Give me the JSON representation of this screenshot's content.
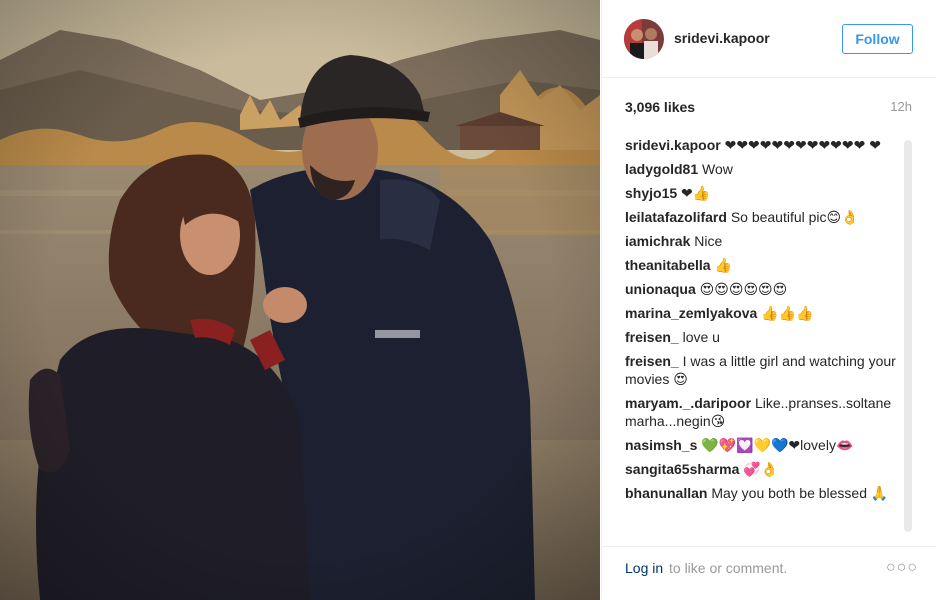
{
  "post": {
    "username": "sridevi.kapoor",
    "follow_label": "Follow",
    "likes": "3,096 likes",
    "time": "12h"
  },
  "comments": [
    {
      "user": "sridevi.kapoor",
      "text": "❤❤❤❤❤❤❤❤❤❤❤❤ ❤"
    },
    {
      "user": "ladygold81",
      "text": "Wow"
    },
    {
      "user": "shyjo15",
      "text": "❤👍"
    },
    {
      "user": "leilatafazolifard",
      "text": "So beautiful pic😊👌"
    },
    {
      "user": "iamichrak",
      "text": "Nice"
    },
    {
      "user": "theanitabella",
      "text": "👍"
    },
    {
      "user": "unionaqua",
      "text": "😍😍😍😍😍😍"
    },
    {
      "user": "marina_zemlyakova",
      "text": "👍👍👍"
    },
    {
      "user": "freisen_",
      "text": "love u"
    },
    {
      "user": "freisen_",
      "text": "I was a little girl and watching your movies 😍"
    },
    {
      "user": "maryam._.daripoor",
      "text": "Like..pranses..soltane marha...negin😘"
    },
    {
      "user": "nasimsh_s",
      "text": "💚💖💟💛💙❤lovely👄"
    },
    {
      "user": "sangita65sharma",
      "text": "💞👌"
    },
    {
      "user": "bhanunallan",
      "text": "May you both be blessed 🙏"
    }
  ],
  "footer": {
    "login_label": "Log in",
    "login_rest": " to like or comment.",
    "more_label": "○○○"
  },
  "colors": {
    "accent": "#3897f0",
    "link": "#003569",
    "muted": "#999999",
    "divider": "#efefef"
  },
  "icons": {
    "more": "more-options-icon"
  }
}
